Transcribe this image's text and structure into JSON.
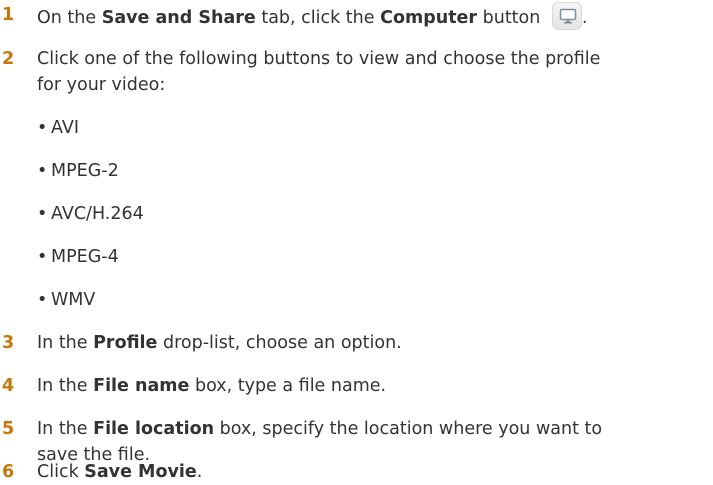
{
  "steps": [
    {
      "number": "1",
      "parts": [
        "On the ",
        "Save and Share",
        " tab, click the ",
        "Computer",
        " button ",
        "."
      ]
    },
    {
      "number": "2",
      "line1": "Click one of the following buttons to view and choose the profile",
      "line2": "for your video:",
      "bullets": [
        "AVI",
        "MPEG-2",
        "AVC/H.264",
        "MPEG-4",
        "WMV"
      ]
    },
    {
      "number": "3",
      "parts": [
        "In the ",
        "Profile",
        " drop-list, choose an option."
      ]
    },
    {
      "number": "4",
      "parts": [
        "In the ",
        "File name",
        " box, type a file name."
      ]
    },
    {
      "number": "5",
      "parts": [
        "In the ",
        "File location",
        " box, specify the location where you want to"
      ],
      "line2": "save the file."
    },
    {
      "number": "6",
      "parts": [
        "Click ",
        "Save Movie",
        "."
      ]
    }
  ],
  "bullet_char": "•",
  "icons": {
    "computer_button": "monitor-icon"
  },
  "colors": {
    "step_number": "#c8780a",
    "text": "#333333"
  }
}
